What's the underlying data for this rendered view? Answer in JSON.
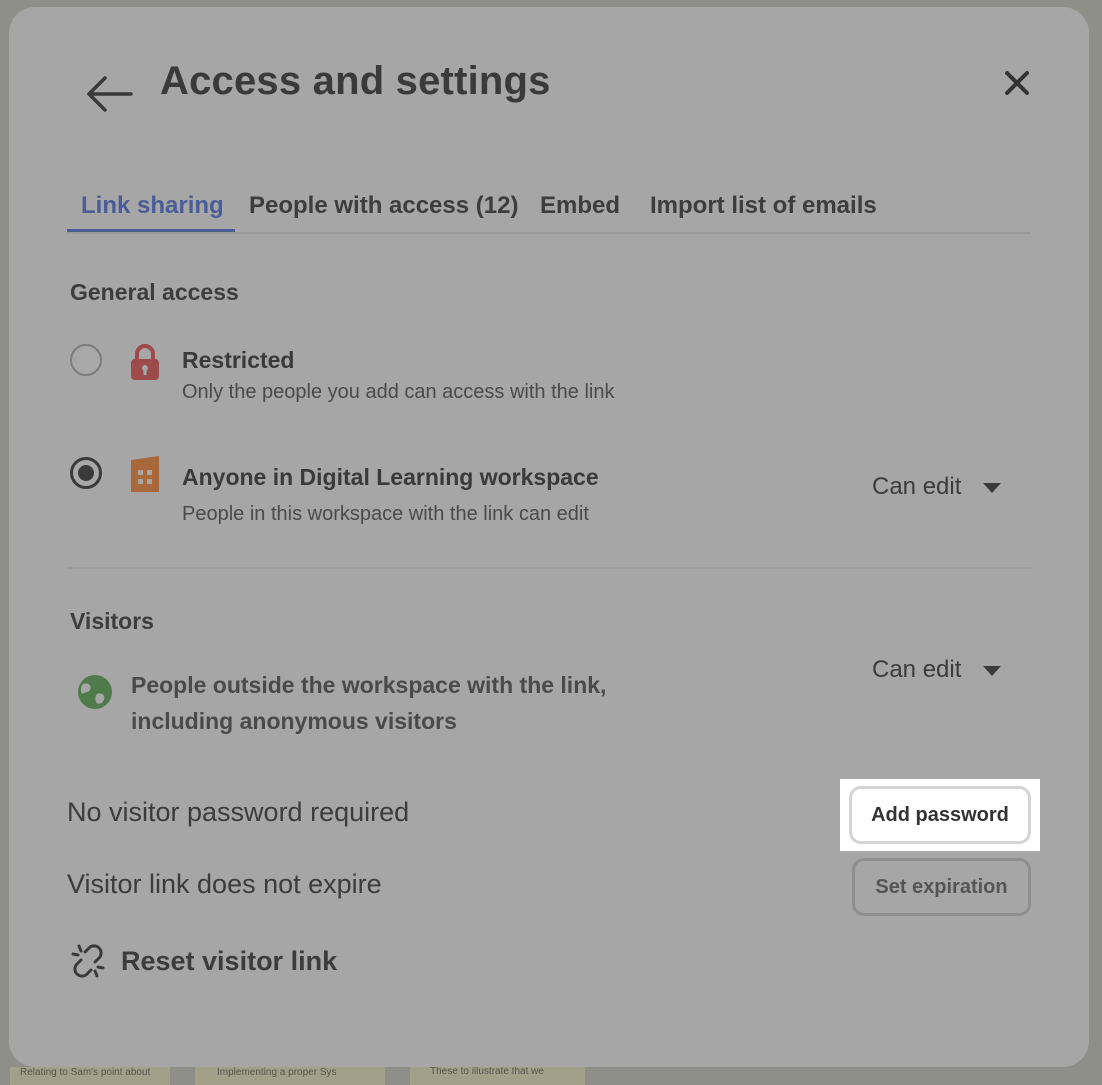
{
  "background": {
    "snippets": [
      "Implementing a proper Sys",
      "These to illustrate that we",
      "Relating to Sam's point about"
    ]
  },
  "modal": {
    "title": "Access and settings",
    "back_icon": "arrow-left-icon",
    "close_icon": "close-icon"
  },
  "tabs": [
    {
      "label": "Link sharing",
      "active": true
    },
    {
      "label": "People with access (12)",
      "active": false
    },
    {
      "label": "Embed",
      "active": false
    },
    {
      "label": "Import list of emails",
      "active": false
    }
  ],
  "general_access": {
    "heading": "General access",
    "options": [
      {
        "title": "Restricted",
        "subtitle": "Only the people you add can access with the link",
        "icon": "lock-icon",
        "selected": false
      },
      {
        "title": "Anyone in Digital Learning workspace",
        "subtitle": "People in this workspace with the link can edit",
        "icon": "building-icon",
        "selected": true,
        "permission": "Can edit"
      }
    ]
  },
  "visitors": {
    "heading": "Visitors",
    "description": "People outside the workspace with the link, including anonymous visitors",
    "icon": "globe-icon",
    "permission": "Can edit"
  },
  "password": {
    "label": "No visitor password required",
    "button": "Add password"
  },
  "expiration": {
    "label": "Visitor link does not expire",
    "button": "Set expiration"
  },
  "reset": {
    "label": "Reset visitor link",
    "icon": "broken-link-icon"
  },
  "colors": {
    "accent": "#4b5d97",
    "lock": "#9c4a4a",
    "building": "#a8683a",
    "globe": "#4f7a4a"
  }
}
